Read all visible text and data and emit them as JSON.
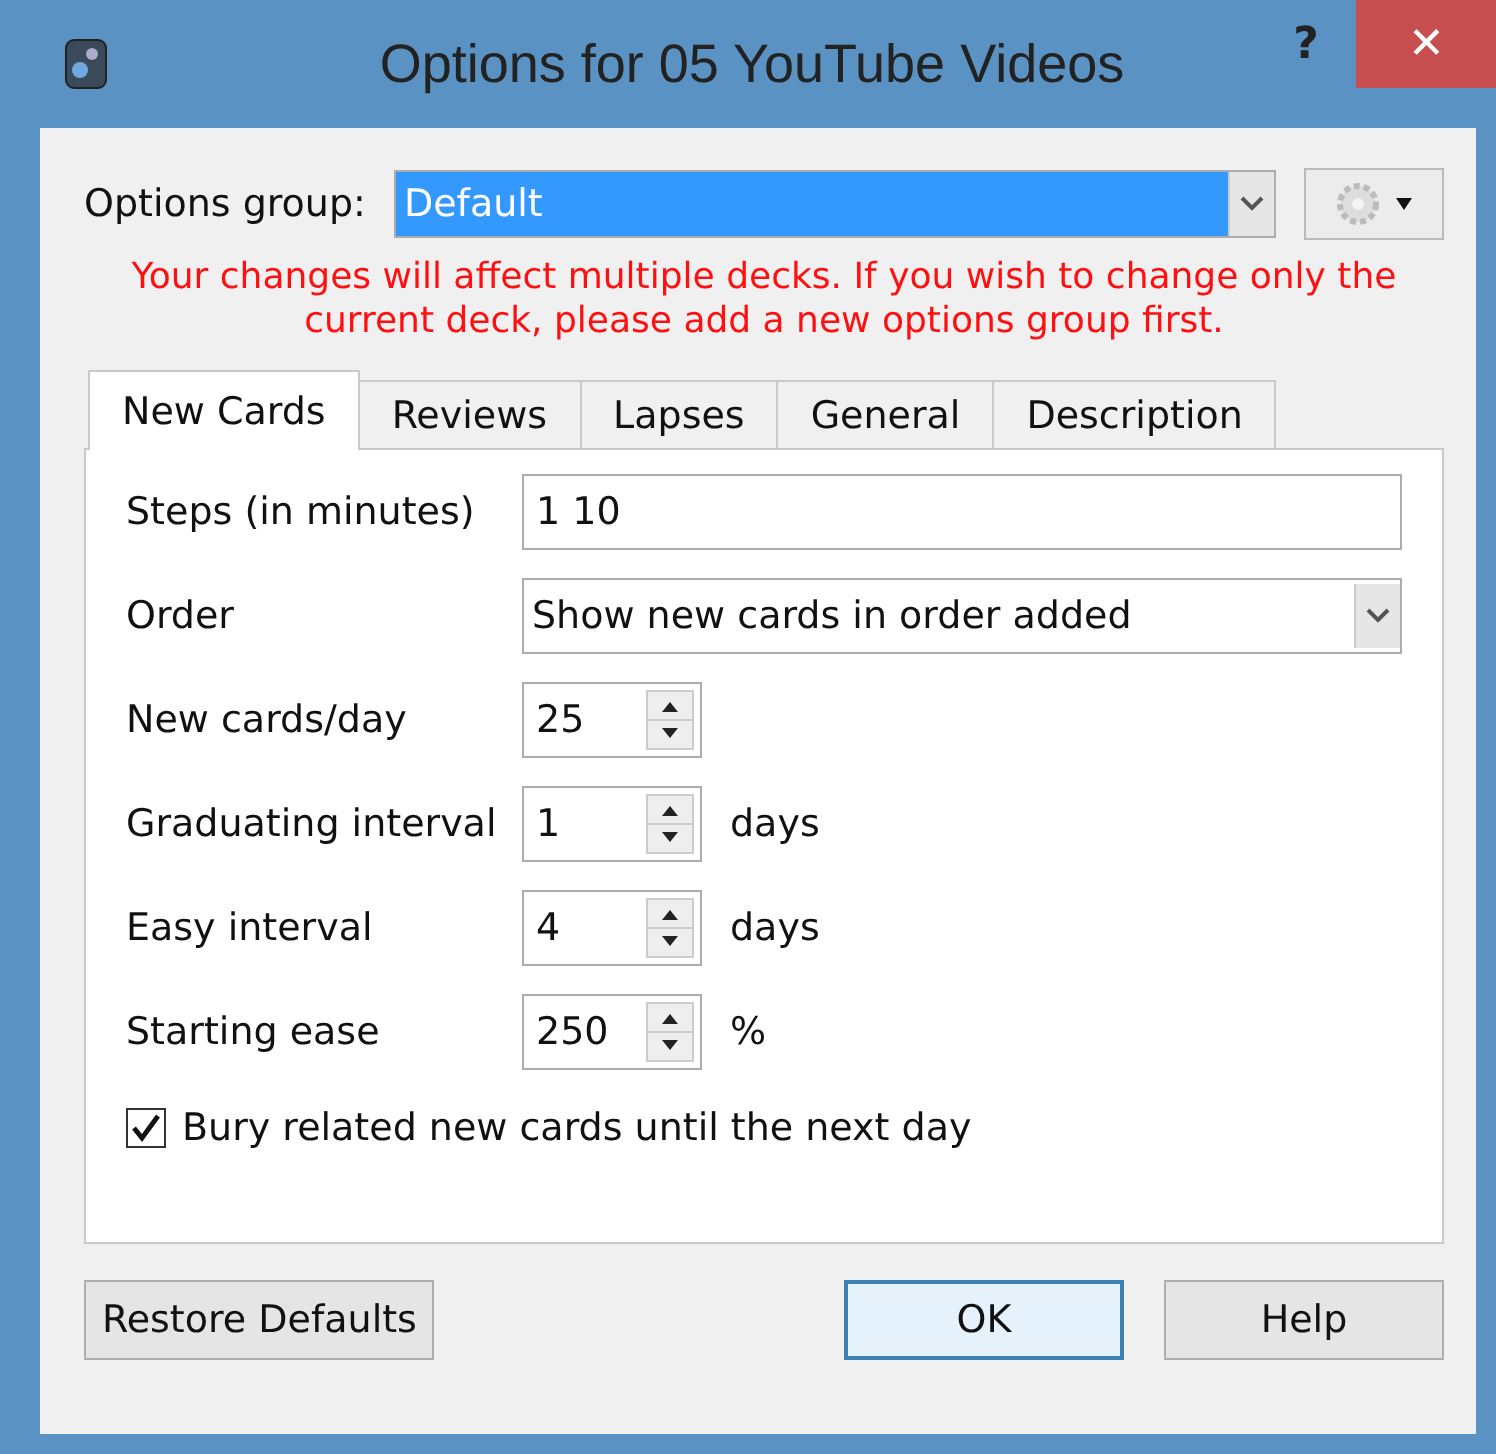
{
  "window": {
    "title": "Options for 05 YouTube Videos",
    "help": "?",
    "close": "✕"
  },
  "options_group": {
    "label": "Options group:",
    "value": "Default"
  },
  "warning": "Your changes will affect multiple decks. If you wish to change only the current deck, please add a new options group first.",
  "tabs": [
    {
      "label": "New Cards",
      "selected": true
    },
    {
      "label": "Reviews",
      "selected": false
    },
    {
      "label": "Lapses",
      "selected": false
    },
    {
      "label": "General",
      "selected": false
    },
    {
      "label": "Description",
      "selected": false
    }
  ],
  "fields": [
    {
      "kind": "text",
      "label": "Steps (in minutes)",
      "value": "1 10"
    },
    {
      "kind": "dropdown",
      "label": "Order",
      "value": "Show new cards in order added"
    },
    {
      "kind": "spinner",
      "label": "New cards/day",
      "value": "25"
    },
    {
      "kind": "spinner",
      "label": "Graduating interval",
      "value": "1",
      "unit": "days"
    },
    {
      "kind": "spinner",
      "label": "Easy interval",
      "value": "4",
      "unit": "days"
    },
    {
      "kind": "spinner",
      "label": "Starting ease",
      "value": "250",
      "unit": "%"
    }
  ],
  "checkbox": {
    "label": "Bury related new cards until the next day",
    "checked": true
  },
  "buttons": [
    {
      "label": "Restore Defaults",
      "kind": "left"
    },
    {
      "label": "OK",
      "kind": "default"
    },
    {
      "label": "Help",
      "kind": "normal"
    }
  ]
}
